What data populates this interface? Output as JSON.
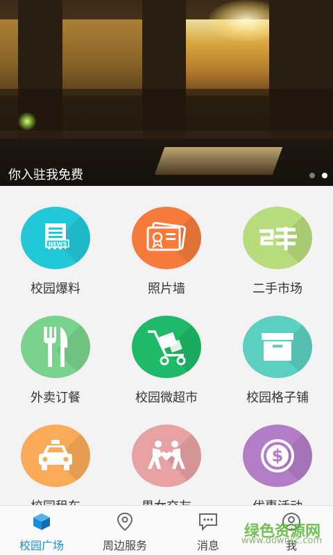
{
  "banner": {
    "caption": "你入驻我免费",
    "pager": {
      "count": 2,
      "active_index": 1
    }
  },
  "grid": {
    "items": [
      {
        "label": "校园爆料",
        "icon": "news-icon",
        "color": "#22c8d8"
      },
      {
        "label": "照片墙",
        "icon": "photo-wall-icon",
        "color": "#f67b3a"
      },
      {
        "label": "二手市场",
        "icon": "second-hand-icon",
        "color": "#b6dc7c"
      },
      {
        "label": "外卖订餐",
        "icon": "fork-knife-icon",
        "color": "#7ad38d"
      },
      {
        "label": "校园微超市",
        "icon": "cart-icon",
        "color": "#1fb96a"
      },
      {
        "label": "校园格子铺",
        "icon": "box-icon",
        "color": "#5cd0c0"
      },
      {
        "label": "校园租车",
        "icon": "taxi-icon",
        "color": "#f9ab58"
      },
      {
        "label": "男女交友",
        "icon": "dating-icon",
        "color": "#e8a2a4"
      },
      {
        "label": "优惠活动",
        "icon": "dollar-icon",
        "color": "#b27cc7"
      }
    ]
  },
  "bottom_nav": {
    "items": [
      {
        "label": "校园广场",
        "icon": "cube-icon",
        "active": true
      },
      {
        "label": "周边服务",
        "icon": "location-pin-icon",
        "active": false
      },
      {
        "label": "消息",
        "icon": "message-icon",
        "active": false
      },
      {
        "label": "我",
        "icon": "user-icon",
        "active": false
      }
    ],
    "active_color": "#1a8fd8"
  },
  "watermark": {
    "text": "绿色资源网",
    "sub": "www.downcc.com"
  }
}
